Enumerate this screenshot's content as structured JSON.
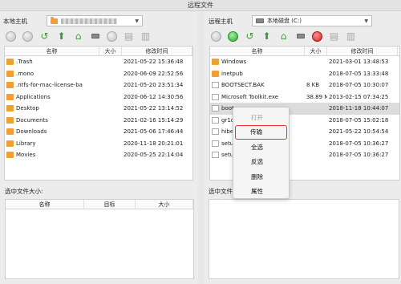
{
  "window": {
    "title": "远程文件"
  },
  "left": {
    "location_label": "本地主机",
    "headers": {
      "name": "名称",
      "size": "大小",
      "time": "修改时间"
    },
    "rows": [
      {
        "name": ".Trash",
        "size": "",
        "time": "2021-05-22 15:36:48",
        "type": "folder"
      },
      {
        "name": ".mono",
        "size": "",
        "time": "2020-06-09 22:52:56",
        "type": "folder"
      },
      {
        "name": ".ntfs-for-mac-license-ba",
        "size": "",
        "time": "2021-05-20 23:51:34",
        "type": "folder"
      },
      {
        "name": "Applications",
        "size": "",
        "time": "2020-06-12 14:30:56",
        "type": "folder"
      },
      {
        "name": "Desktop",
        "size": "",
        "time": "2021-05-22 13:14:52",
        "type": "folder"
      },
      {
        "name": "Documents",
        "size": "",
        "time": "2021-02-16 15:14:29",
        "type": "folder"
      },
      {
        "name": "Downloads",
        "size": "",
        "time": "2021-05-06 17:46:44",
        "type": "folder"
      },
      {
        "name": "Library",
        "size": "",
        "time": "2020-11-18 20:21:01",
        "type": "folder"
      },
      {
        "name": "Movies",
        "size": "",
        "time": "2020-05-25 22:14:04",
        "type": "folder"
      }
    ],
    "selected_size_label": "选中文件大小:",
    "queue_headers": {
      "name": "名称",
      "target": "目标",
      "size": "大小"
    }
  },
  "right": {
    "location_label": "远程主机",
    "drive": "本地磁盘 (C:)",
    "headers": {
      "name": "名称",
      "size": "大小",
      "time": "修改时间"
    },
    "rows": [
      {
        "name": "Windows",
        "size": "",
        "time": "2021-03-01 13:48:53",
        "type": "folder"
      },
      {
        "name": "inetpub",
        "size": "",
        "time": "2018-07-05 13:33:48",
        "type": "folder"
      },
      {
        "name": "BOOTSECT.BAK",
        "size": "8 KB",
        "time": "2018-07-05 10:30:07",
        "type": "file"
      },
      {
        "name": "Microsoft Toolkit.exe",
        "size": "38.89 MB",
        "time": "2013-02-15 07:34:25",
        "type": "file"
      },
      {
        "name": "bootr",
        "size": "",
        "time": "2018-11-18 10:44:07",
        "type": "file"
      },
      {
        "name": "gr1d",
        "size": "",
        "time": "2018-07-05 15:02:18",
        "type": "file"
      },
      {
        "name": "hiber",
        "size": "",
        "time": "2021-05-22 10:54:54",
        "type": "file"
      },
      {
        "name": "setup",
        "size": "",
        "time": "2018-07-05 10:36:27",
        "type": "file"
      },
      {
        "name": "setup",
        "size": "",
        "time": "2018-07-05 10:36:27",
        "type": "file"
      }
    ],
    "selected_size_label": "选中文件大小:"
  },
  "context_menu": {
    "items": [
      {
        "label": "打开",
        "disabled": true
      },
      {
        "label": "传输",
        "highlighted": true
      },
      {
        "label": "全选"
      },
      {
        "label": "反选"
      },
      {
        "label": "删除"
      },
      {
        "label": "属性"
      }
    ]
  },
  "colors": {
    "accent_red": "#e0362e",
    "folder": "#f0a030",
    "green": "#3c9a3c"
  }
}
